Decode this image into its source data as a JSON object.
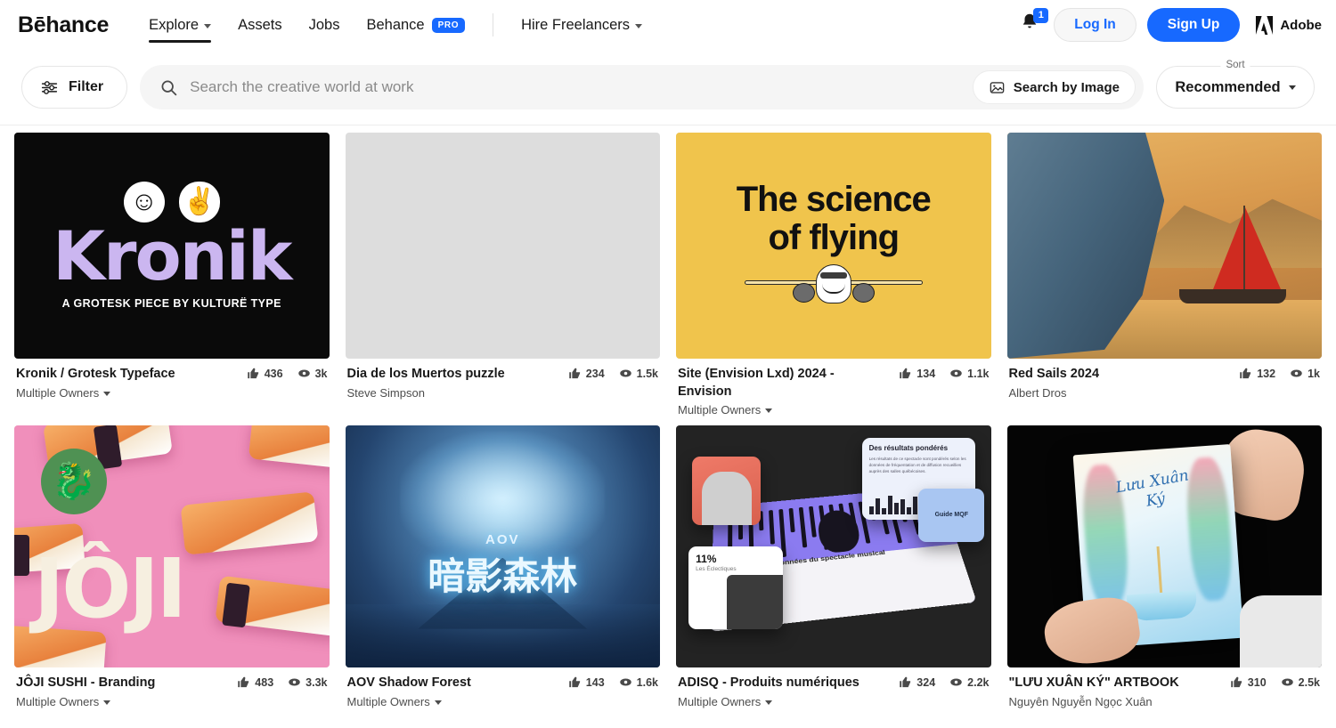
{
  "header": {
    "logo": "Bēhance",
    "nav": [
      {
        "label": "Explore",
        "has_caret": true,
        "active": true
      },
      {
        "label": "Assets",
        "has_caret": false,
        "active": false
      },
      {
        "label": "Jobs",
        "has_caret": false,
        "active": false
      },
      {
        "label": "Behance",
        "badge": "PRO",
        "has_caret": false,
        "active": false
      },
      {
        "label": "Hire Freelancers",
        "has_caret": true,
        "active": false
      }
    ],
    "notifications_count": "1",
    "login_label": "Log In",
    "signup_label": "Sign Up",
    "adobe_label": "Adobe"
  },
  "searchbar": {
    "filter_label": "Filter",
    "search_placeholder": "Search the creative world at work",
    "search_by_image_label": "Search by Image",
    "sort_label": "Sort",
    "sort_value": "Recommended"
  },
  "projects": [
    {
      "title": "Kronik / Grotesk Typeface",
      "owner": "Multiple Owners",
      "owner_is_multiple": true,
      "likes": "436",
      "views": "3k",
      "art": {
        "word": "Kronik",
        "tagline": "A GROTESK PIECE BY KULTURË TYPE",
        "sticker_1": "☺",
        "sticker_2": "✌",
        "bg_color": "#0a0a0a",
        "text_color": "#cbb6f0"
      }
    },
    {
      "title": "Dia de los Muertos puzzle",
      "owner": "Steve Simpson",
      "owner_is_multiple": false,
      "likes": "234",
      "views": "1.5k",
      "art": {
        "bg_color": "#2b1630"
      }
    },
    {
      "title": "Site (Envision Lxd) 2024 - Envision",
      "owner": "Multiple Owners",
      "owner_is_multiple": true,
      "likes": "134",
      "views": "1.1k",
      "art": {
        "line1": "The science",
        "line2": "of flying",
        "bg_color": "#f0c44c",
        "text_color": "#111111"
      }
    },
    {
      "title": "Red Sails 2024",
      "owner": "Albert Dros",
      "owner_is_multiple": false,
      "likes": "132",
      "views": "1k",
      "art": {
        "sail_color": "#cf2b20"
      }
    },
    {
      "title": "JÔJI SUSHI - Branding",
      "owner": "Multiple Owners",
      "owner_is_multiple": true,
      "likes": "483",
      "views": "3.3k",
      "art": {
        "word": "JÔJI",
        "badge_glyph": "🐉",
        "bg_color": "#f08fbb",
        "badge_color": "#4f9153",
        "text_color": "#f6efe0"
      }
    },
    {
      "title": "AOV Shadow Forest",
      "owner": "Multiple Owners",
      "owner_is_multiple": true,
      "likes": "143",
      "views": "1.6k",
      "art": {
        "logo": "AOV",
        "calligraphy": "暗影森林"
      }
    },
    {
      "title": "ADISQ - Produits numériques",
      "owner": "Multiple Owners",
      "owner_is_multiple": true,
      "likes": "324",
      "views": "2.2k",
      "art": {
        "card_results_title": "Des résultats pondérés",
        "card_results_body": "Les résultats de ce spectacle sont pondérés selon les données de fréquentation et de diffusion recueillies auprès des salles québécoises.",
        "card_guide": "Guide MQF",
        "card_stat_number": "11%",
        "card_stat_label": "Les Éclectiques",
        "screen_caption": "Espace de données du spectacle musical québécois",
        "bg_color": "#232323"
      }
    },
    {
      "title": "\"LƯU XUÂN KÝ\" ARTBOOK",
      "owner": "Nguyên Nguyễn Ngọc Xuân",
      "owner_is_multiple": false,
      "likes": "310",
      "views": "2.5k",
      "art": {
        "cover_script": "Lưu\nXuân\nKý",
        "bg_color": "#050505"
      }
    }
  ],
  "icons": {
    "like": "like-icon",
    "view": "view-icon",
    "search": "search-icon",
    "filter": "filter-icon",
    "bell": "bell-icon",
    "image": "image-icon"
  }
}
